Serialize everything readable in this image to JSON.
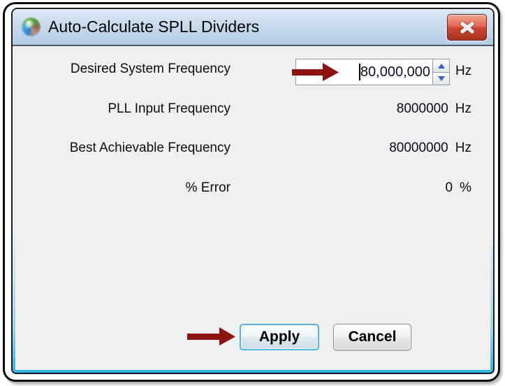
{
  "window": {
    "title": "Auto-Calculate SPLL Dividers",
    "icon": "app-logo-sphere",
    "close_icon": "close-x"
  },
  "rows": [
    {
      "label": "Desired System Frequency",
      "value": "80,000,000",
      "unit": "Hz"
    },
    {
      "label": "PLL Input Frequency",
      "value": "8000000",
      "unit": "Hz"
    },
    {
      "label": "Best Achievable Frequency",
      "value": "80000000",
      "unit": "Hz"
    },
    {
      "label": "% Error",
      "value": "0",
      "unit": "%"
    }
  ],
  "buttons": {
    "apply": "Apply",
    "cancel": "Cancel"
  },
  "spinner": {
    "up_icon": "spin-up-triangle",
    "down_icon": "spin-down-triangle"
  },
  "annotations": {
    "arrow_color": "#8c130f",
    "arrows": [
      "arrow-pointing-at-frequency-input",
      "arrow-pointing-at-apply-button"
    ]
  },
  "colors": {
    "titlebar_top": "#dfeaf7",
    "titlebar_bottom": "#b3cbe5",
    "client_bg": "#f0f0f0",
    "frame_accent_cyan": "#2fb2e9",
    "close_button_red": "#ce452f",
    "apply_border_blue": "#4fb3e4"
  }
}
